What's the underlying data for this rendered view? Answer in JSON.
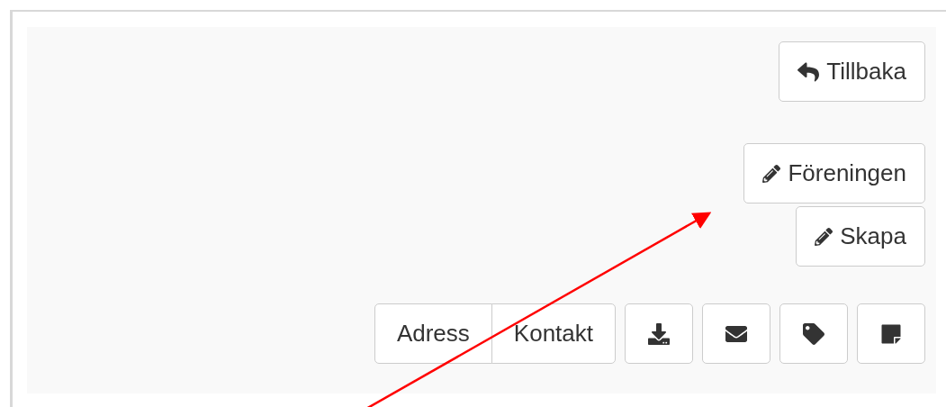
{
  "back_button": {
    "label": "Tillbaka"
  },
  "edit_buttons": [
    {
      "label": "Föreningen"
    },
    {
      "label": "Skapa"
    }
  ],
  "segmented": [
    "Adress",
    "Kontakt"
  ]
}
